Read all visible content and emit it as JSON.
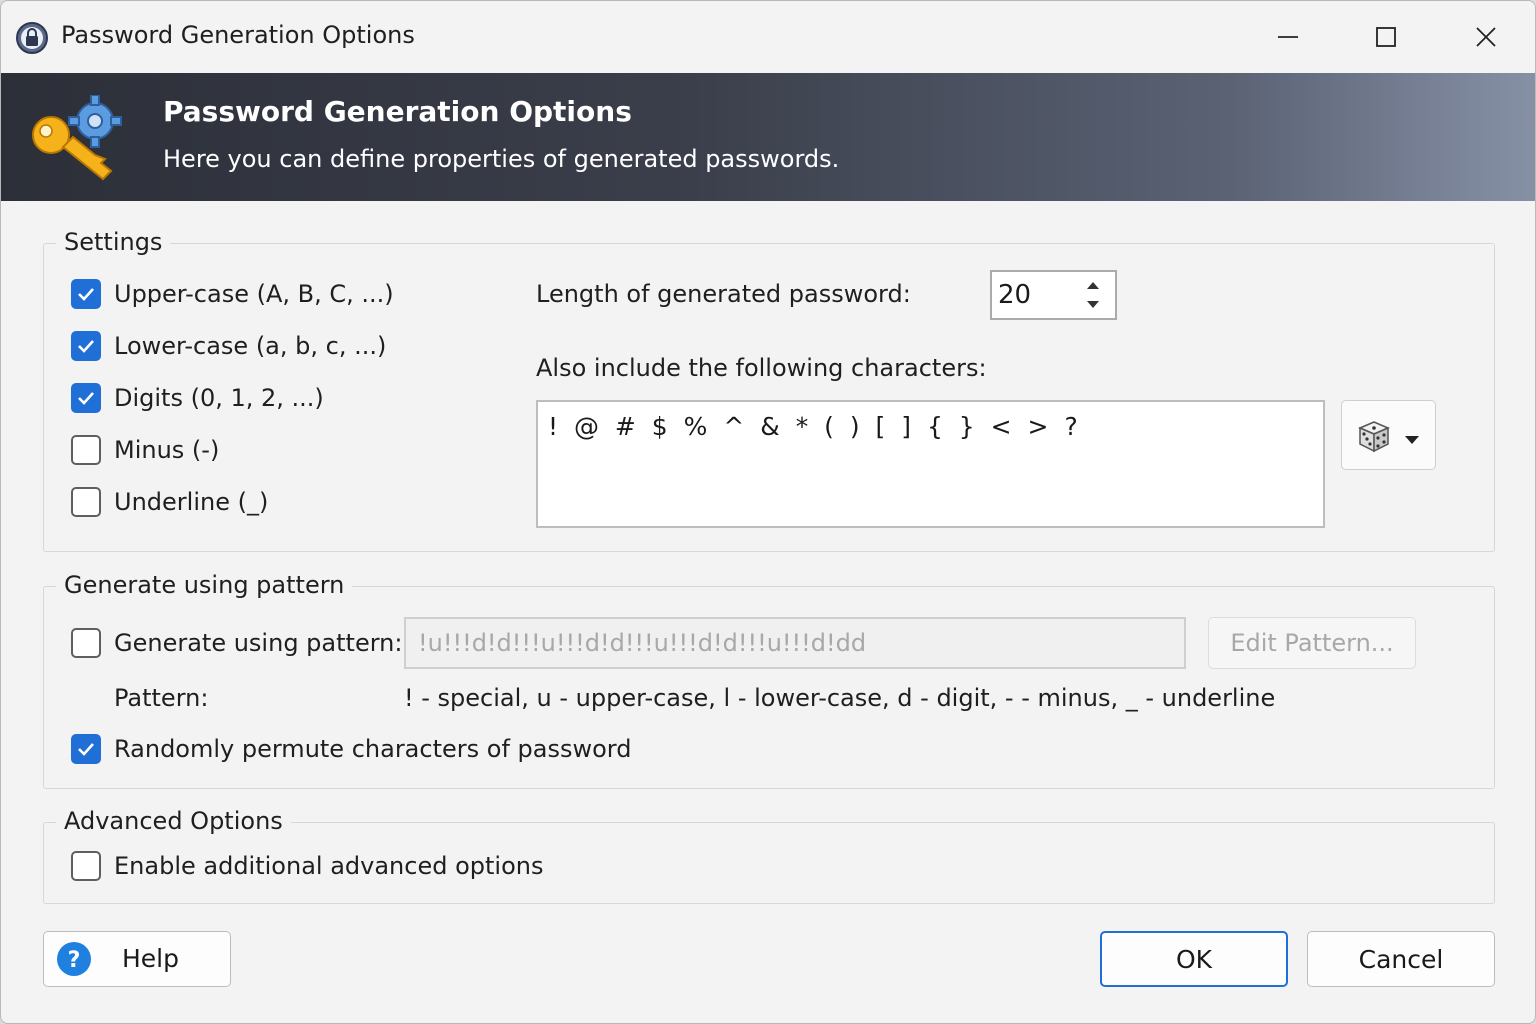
{
  "window": {
    "title": "Password Generation Options",
    "icons": {
      "app": "lock-icon",
      "minimize": "minimize-icon",
      "maximize": "maximize-icon",
      "close": "close-icon"
    }
  },
  "banner": {
    "title": "Password Generation Options",
    "subtitle": "Here you can define properties of generated passwords.",
    "icon": "key-gear-icon"
  },
  "settings": {
    "legend": "Settings",
    "checkboxes": [
      {
        "label": "Upper-case (A, B, C, ...)",
        "checked": true
      },
      {
        "label": "Lower-case (a, b, c, ...)",
        "checked": true
      },
      {
        "label": "Digits (0, 1, 2, ...)",
        "checked": true
      },
      {
        "label": "Minus (-)",
        "checked": false
      },
      {
        "label": "Underline (_)",
        "checked": false
      }
    ],
    "length_label": "Length of generated password:",
    "length_value": "20",
    "also_include_label": "Also include the following characters:",
    "also_include_value": "! @ # $ % ^ & * ( ) [ ] { } < > ?",
    "dice_icon": "dice-icon"
  },
  "pattern": {
    "legend": "Generate using pattern",
    "checkbox_label": "Generate using pattern:",
    "checkbox_checked": false,
    "pattern_value": "!u!!!d!d!!!u!!!d!d!!!u!!!d!d!!!u!!!d!dd",
    "edit_button": "Edit Pattern...",
    "pattern_label": "Pattern:",
    "pattern_help": "! - special, u - upper-case, l - lower-case, d - digit, - - minus, _ - underline",
    "permute_label": "Randomly permute characters of password",
    "permute_checked": true
  },
  "advanced": {
    "legend": "Advanced Options",
    "checkbox_label": "Enable additional advanced options",
    "checkbox_checked": false
  },
  "footer": {
    "help": "Help",
    "ok": "OK",
    "cancel": "Cancel",
    "help_icon": "help-icon"
  },
  "colors": {
    "accent": "#1f6fd6",
    "banner_dark": "#2c2f38",
    "banner_light": "#8791a6"
  }
}
